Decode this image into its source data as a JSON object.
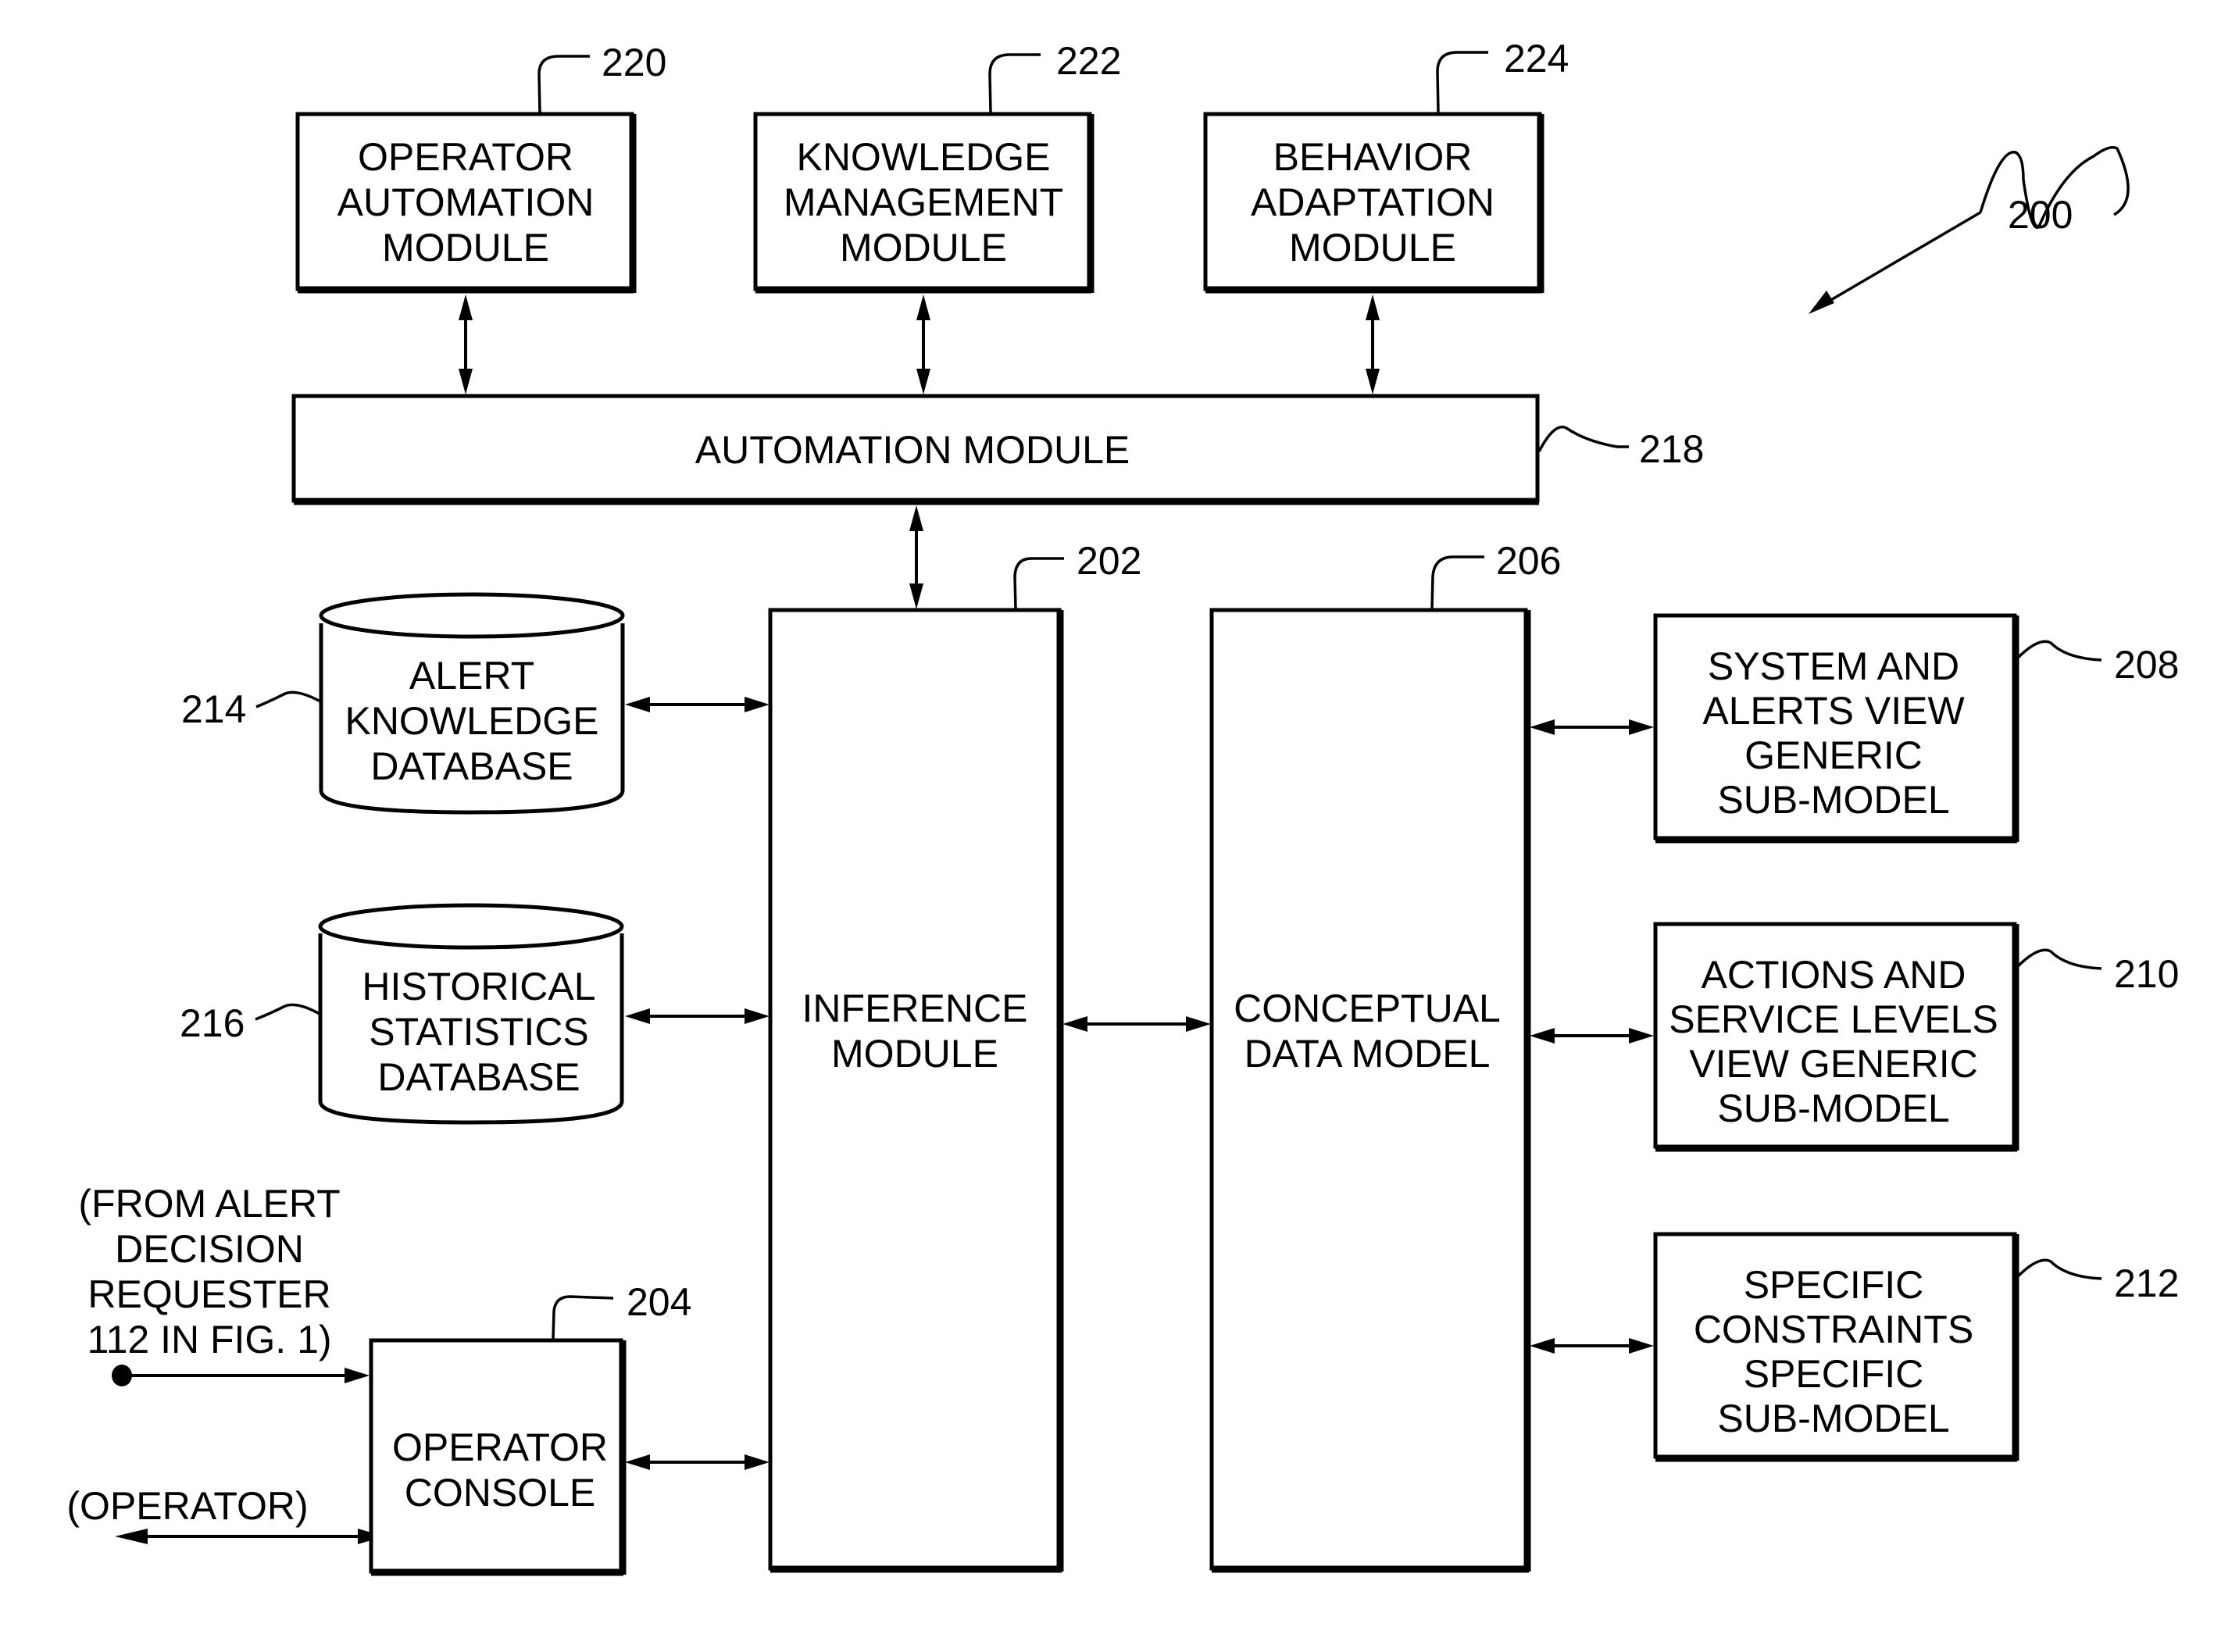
{
  "figure": {
    "ref": "200",
    "blocks": {
      "operator_automation": {
        "ref": "220",
        "lines": [
          "OPERATOR",
          "AUTOMATION",
          "MODULE"
        ]
      },
      "knowledge_management": {
        "ref": "222",
        "lines": [
          "KNOWLEDGE",
          "MANAGEMENT",
          "MODULE"
        ]
      },
      "behavior_adaptation": {
        "ref": "224",
        "lines": [
          "BEHAVIOR",
          "ADAPTATION",
          "MODULE"
        ]
      },
      "automation": {
        "ref": "218",
        "lines": [
          "AUTOMATION MODULE"
        ]
      },
      "inference": {
        "ref": "202",
        "lines": [
          "INFERENCE",
          "MODULE"
        ]
      },
      "conceptual": {
        "ref": "206",
        "lines": [
          "CONCEPTUAL",
          "DATA MODEL"
        ]
      },
      "alert_db": {
        "ref": "214",
        "lines": [
          "ALERT",
          "KNOWLEDGE",
          "DATABASE"
        ]
      },
      "historical_db": {
        "ref": "216",
        "lines": [
          "HISTORICAL",
          "STATISTICS",
          "DATABASE"
        ]
      },
      "operator_console": {
        "ref": "204",
        "lines": [
          "OPERATOR",
          "CONSOLE"
        ]
      },
      "system_alerts": {
        "ref": "208",
        "lines": [
          "SYSTEM AND",
          "ALERTS VIEW",
          "GENERIC",
          "SUB-MODEL"
        ]
      },
      "actions_service": {
        "ref": "210",
        "lines": [
          "ACTIONS AND",
          "SERVICE LEVELS",
          "VIEW GENERIC",
          "SUB-MODEL"
        ]
      },
      "specific_constraints": {
        "ref": "212",
        "lines": [
          "SPECIFIC",
          "CONSTRAINTS",
          "SPECIFIC",
          "SUB-MODEL"
        ]
      }
    },
    "annotations": {
      "from_requester": [
        "(FROM ALERT",
        "DECISION",
        "REQUESTER",
        "112 IN FIG. 1)"
      ],
      "operator": "(OPERATOR)"
    }
  }
}
